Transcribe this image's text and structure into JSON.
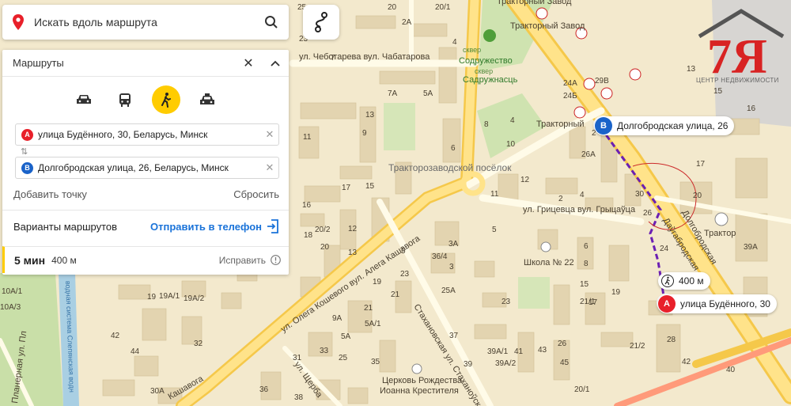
{
  "search": {
    "placeholder": "Искать вдоль маршрута"
  },
  "routes": {
    "title": "Маршруты",
    "modes": [
      "car-mode",
      "bus-mode",
      "walk-mode",
      "taxi-mode"
    ],
    "point_a": {
      "badge": "A",
      "address": "улица Будённого, 30, Беларусь, Минск"
    },
    "point_b": {
      "badge": "B",
      "address": "Долгобродская улица, 26, Беларусь, Минск"
    },
    "add_point": "Добавить точку",
    "reset": "Сбросить",
    "variants": "Варианты маршрутов",
    "send_phone": "Отправить в телефон",
    "result": {
      "time": "5 мин",
      "distance": "400 м",
      "fix": "Исправить"
    }
  },
  "map": {
    "marker_a": {
      "badge": "A",
      "label": "улица Будённого, 30"
    },
    "marker_b": {
      "badge": "B",
      "label": "Долгобродская улица, 26"
    },
    "distance_chip": "400 м",
    "district": "Тракторозаводской посёлок",
    "streets": {
      "chebotareva": "ул. Чеботарева вул. Чабатарова",
      "gritsevca": "ул. Грицевца вул. Грыцаўца",
      "koshevogo": "ул. Олега Кошевого вул. Алега Кашавога",
      "koshevogo_short": "Кашавога",
      "stahanovskaya": "Стахановская ул. Стаханоўская",
      "dolgobrodskaya": "Долгобродская",
      "daugabrodskaya": "Даўгабродская",
      "planernaya": "Планерная ул. Пл",
      "shcherba": "ул. Щерба",
      "water_system": "водная система Слепянская водн"
    },
    "pois": {
      "tractor_plant": "Тракторный Завод",
      "tractor_plant_2": "Тракторный Завод",
      "tractor_stop": "Тракторный",
      "square": "сквер",
      "sodruzhestvo": "Содружество",
      "square_by": "сквер",
      "sodruzhnast": "Садружнасць",
      "school": "Школа № 22",
      "church": "Церковь Рождества Иоанна Крестителя",
      "tractor_metro": "Трактор"
    },
    "houses": [
      "25",
      "23",
      "20",
      "20/1",
      "2А",
      "26А",
      "7",
      "11",
      "7А",
      "5А",
      "13",
      "9",
      "2",
      "4",
      "6",
      "8",
      "10",
      "29В",
      "24Б",
      "24А",
      "22",
      "30",
      "26",
      "24",
      "13",
      "16",
      "15",
      "17",
      "18",
      "20",
      "20/2",
      "12",
      "5",
      "3",
      "36/4",
      "3А",
      "25А",
      "19",
      "21",
      "23",
      "19А/1",
      "19А/2",
      "10А/1",
      "10А/3",
      "9А",
      "5А/1",
      "5А",
      "21",
      "31",
      "33",
      "35",
      "39А/1",
      "39А/2",
      "39",
      "41",
      "43",
      "45",
      "30А",
      "36",
      "38",
      "20/1",
      "21/1",
      "21/2",
      "26",
      "28",
      "39А",
      "40",
      "42",
      "44",
      "32"
    ],
    "logo_caption": "ЦЕНТР НЕДВИЖИМОСТИ"
  },
  "colors": {
    "accent": "#ffcc00",
    "marker_a": "#e8202a",
    "marker_b": "#1a63c9",
    "route": "#6b1fb3",
    "link": "#1a73d9"
  }
}
